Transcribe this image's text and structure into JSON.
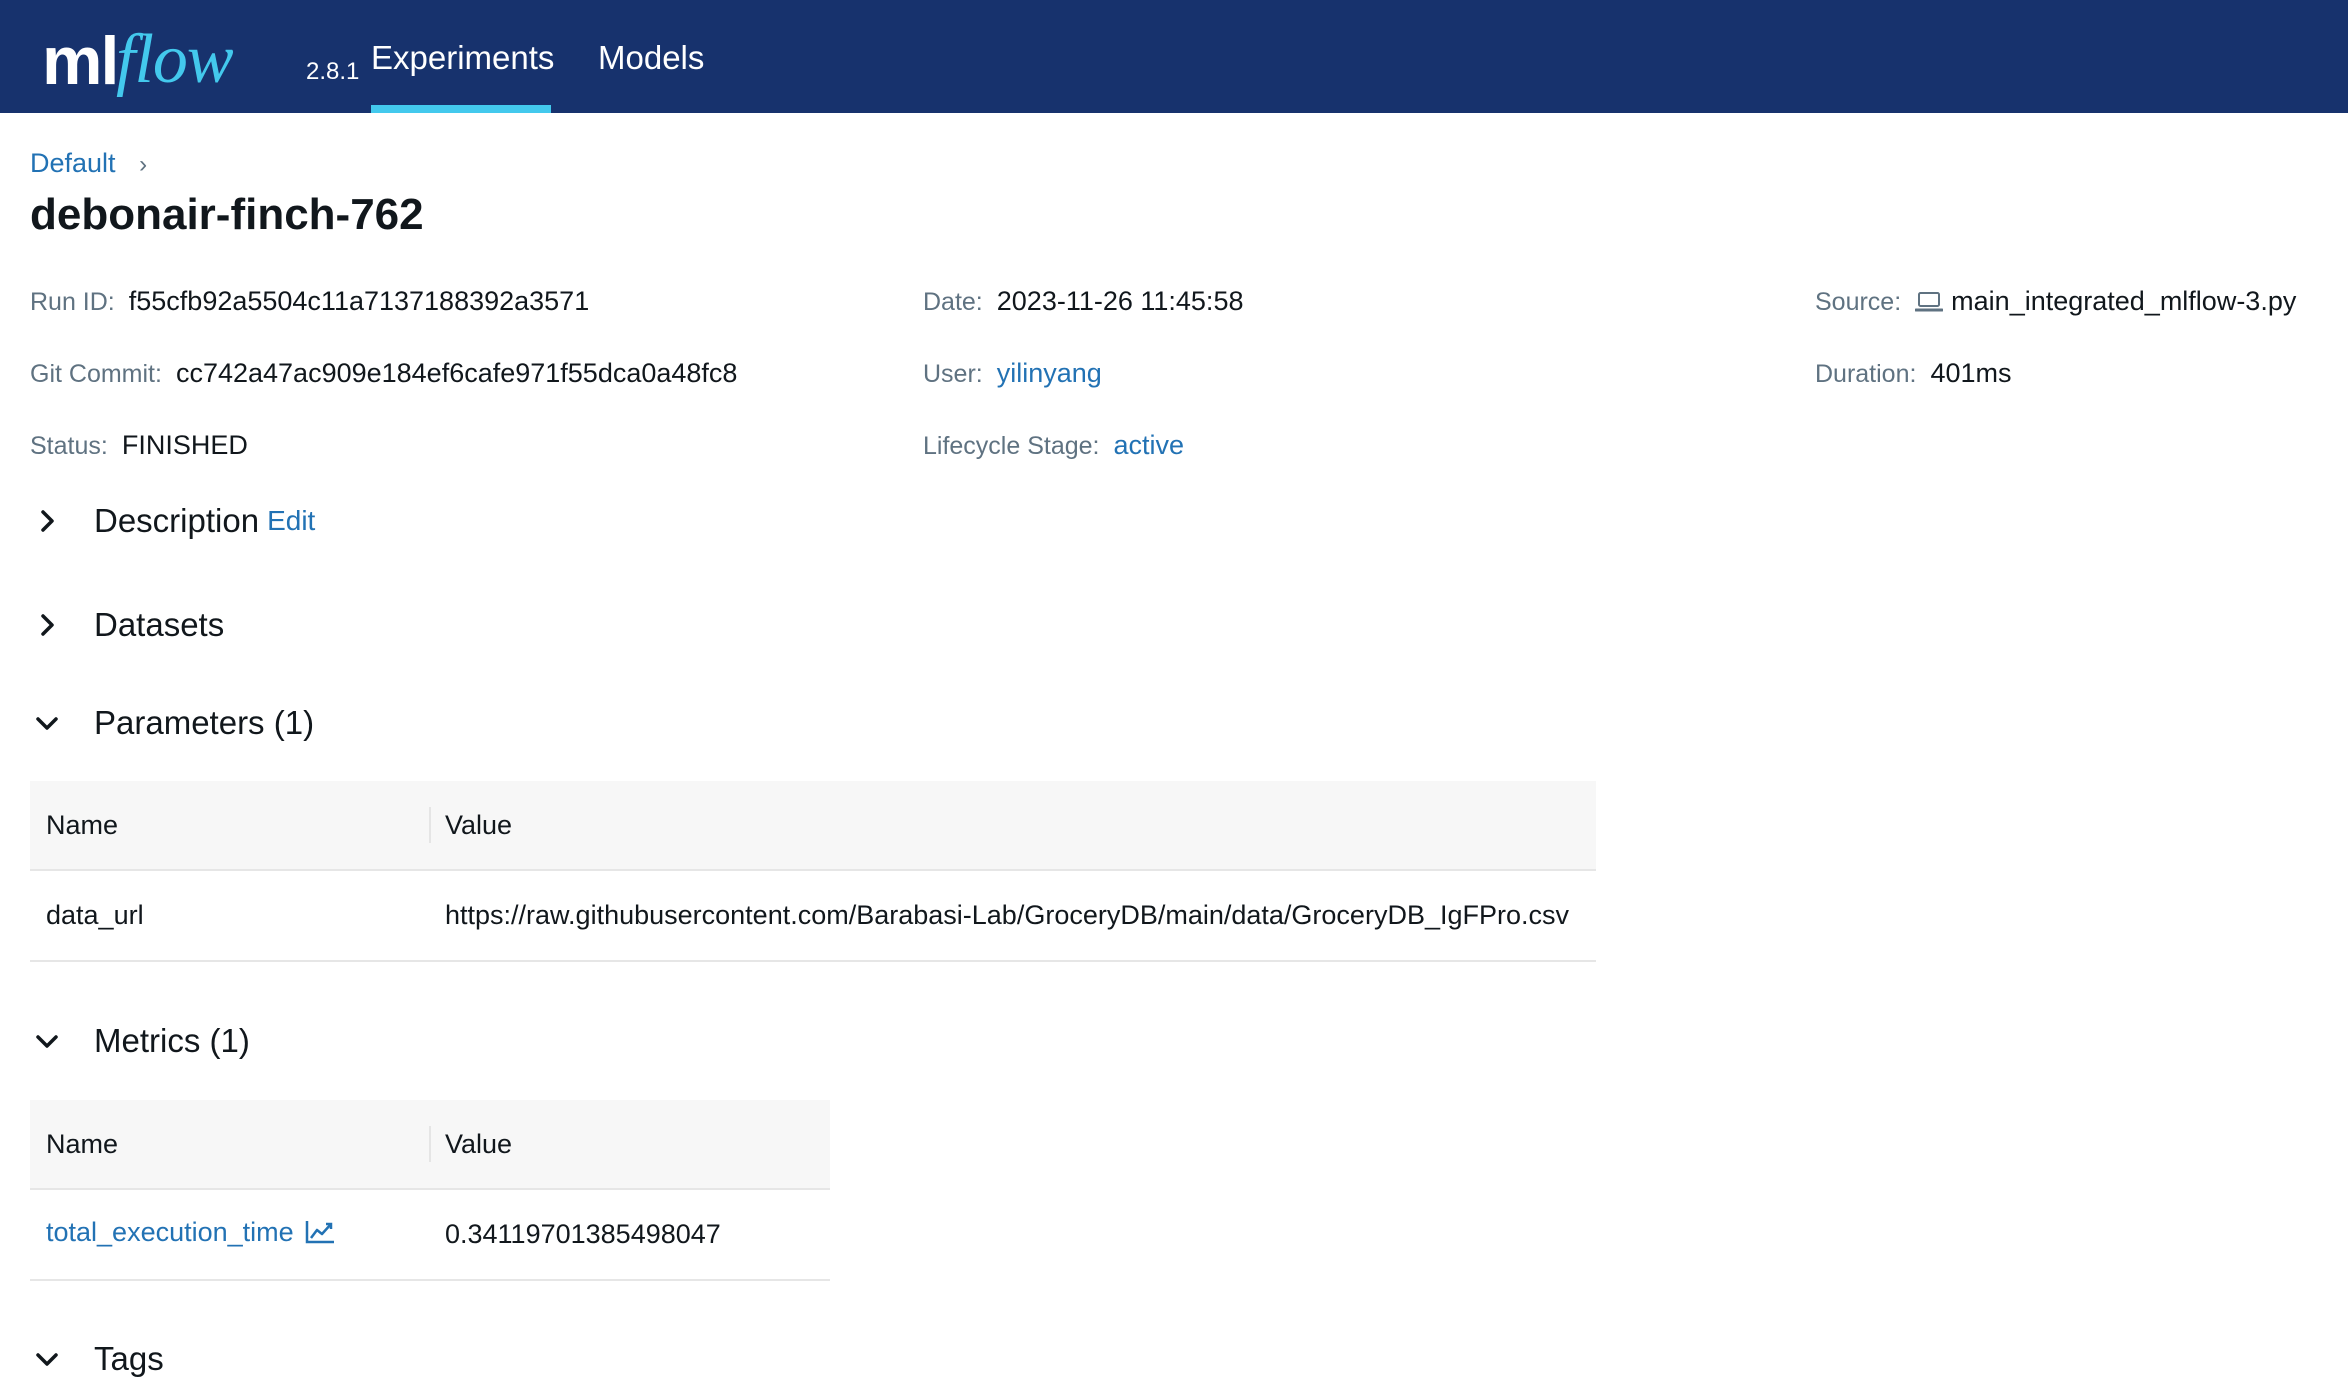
{
  "app": {
    "logo_ml": "ml",
    "logo_flow": "flow",
    "version": "2.8.1",
    "accent": "#43c9ed",
    "header_bg": "#17326d"
  },
  "nav": {
    "tabs": [
      {
        "label": "Experiments",
        "active": true
      },
      {
        "label": "Models",
        "active": false
      }
    ]
  },
  "breadcrumb": {
    "experiment": "Default",
    "separator": "›"
  },
  "run": {
    "title": "debonair-finch-762",
    "fields": {
      "run_id": {
        "label": "Run ID:",
        "value": "f55cfb92a5504c11a7137188392a3571"
      },
      "date": {
        "label": "Date:",
        "value": "2023-11-26 11:45:58"
      },
      "source": {
        "label": "Source:",
        "value": "main_integrated_mlflow-3.py",
        "icon": "laptop-icon"
      },
      "git_commit": {
        "label": "Git Commit:",
        "value": "cc742a47ac909e184ef6cafe971f55dca0a48fc8"
      },
      "user": {
        "label": "User:",
        "value": "yilinyang"
      },
      "duration": {
        "label": "Duration:",
        "value": "401ms"
      },
      "status": {
        "label": "Status:",
        "value": "FINISHED"
      },
      "lifecycle": {
        "label": "Lifecycle Stage:",
        "value": "active"
      }
    }
  },
  "sections": {
    "description": {
      "label": "Description",
      "edit": "Edit",
      "expanded": false
    },
    "datasets": {
      "label": "Datasets",
      "expanded": false
    },
    "parameters": {
      "label": "Parameters (1)",
      "expanded": true
    },
    "metrics": {
      "label": "Metrics (1)",
      "expanded": true
    },
    "tags": {
      "label": "Tags",
      "expanded": true
    }
  },
  "parameters_table": {
    "columns": [
      "Name",
      "Value"
    ],
    "rows": [
      {
        "name": "data_url",
        "value": "https://raw.githubusercontent.com/Barabasi-Lab/GroceryDB/main/data/GroceryDB_IgFPro.csv"
      }
    ]
  },
  "metrics_table": {
    "columns": [
      "Name",
      "Value"
    ],
    "rows": [
      {
        "name": "total_execution_time",
        "value": "0.34119701385498047",
        "icon": "line-chart-icon"
      }
    ]
  }
}
